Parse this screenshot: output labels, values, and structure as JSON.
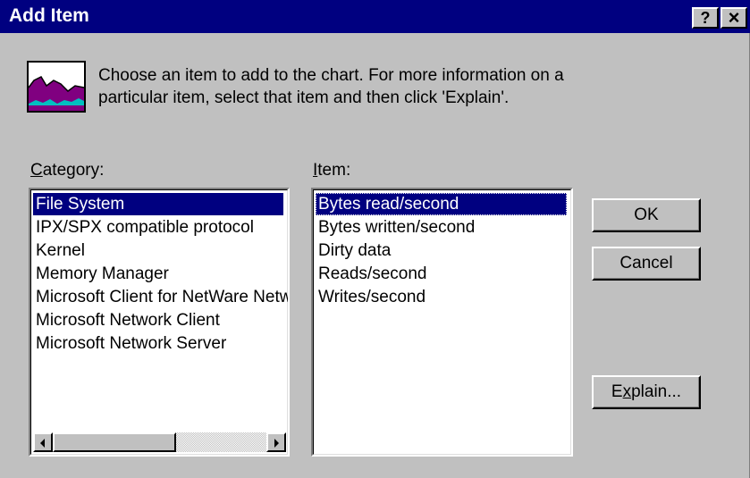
{
  "window": {
    "title": "Add Item",
    "help_button": "?",
    "close_button": "×"
  },
  "intro": {
    "line1": "Choose an item to add to the chart.  For more information on a",
    "line2": "particular item, select that item and then click 'Explain'."
  },
  "category": {
    "label_accel": "C",
    "label_rest": "ategory:",
    "items": [
      "File System",
      "IPX/SPX compatible protocol",
      "Kernel",
      "Memory Manager",
      "Microsoft Client for NetWare Networks",
      "Microsoft Network Client",
      "Microsoft Network Server"
    ],
    "selected": "File System"
  },
  "item": {
    "label_accel": "I",
    "label_rest": "tem:",
    "items": [
      "Bytes read/second",
      "Bytes written/second",
      "Dirty data",
      "Reads/second",
      "Writes/second"
    ],
    "selected": "Bytes read/second"
  },
  "buttons": {
    "ok": "OK",
    "cancel": "Cancel",
    "explain_pre": "E",
    "explain_accel": "x",
    "explain_post": "plain..."
  },
  "icons": {
    "chart": "chart-icon",
    "scroll_left": "scroll-left-icon",
    "scroll_right": "scroll-right-icon"
  },
  "colors": {
    "title_bar": "#000080",
    "dialog_face": "#c0c0c0",
    "selection": "#000080",
    "chart_purple": "#800080",
    "chart_teal": "#00c0c0"
  }
}
